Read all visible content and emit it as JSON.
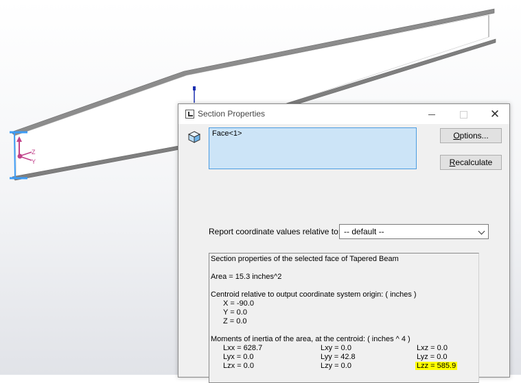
{
  "dialog": {
    "title": "Section Properties",
    "selection_items": [
      "Face<1>"
    ],
    "buttons": {
      "options": {
        "prefix": "",
        "mnemonic": "O",
        "rest": "ptions..."
      },
      "recalculate": {
        "prefix": "",
        "mnemonic": "R",
        "rest": "ecalculate"
      }
    },
    "report_label": "Report coordinate values relative to:",
    "coordinate_system": "-- default --",
    "results": {
      "heading": "Section properties of the selected face of Tapered Beam",
      "area": "Area = 15.3 inches^2",
      "centroid_heading": "Centroid relative to output coordinate system origin: ( inches )",
      "centroid": [
        "X = -90.0",
        "Y = 0.0",
        "Z = 0.0"
      ],
      "moments_heading": "Moments of inertia of the area, at the centroid: ( inches ^ 4 )",
      "moments": [
        [
          "Lxx = 628.7",
          "Lxy = 0.0",
          "Lxz = 0.0"
        ],
        [
          "Lyx = 0.0",
          "Lyy = 42.8",
          "Lyz = 0.0"
        ],
        [
          "Lzx = 0.0",
          "Lzy = 0.0",
          "Lzz = 585.9"
        ]
      ]
    }
  },
  "viewport": {
    "axis_labels": {
      "z": "Z",
      "y": "Y"
    }
  },
  "colors": {
    "selection_face": "#cce4f7",
    "selection_border": "#4a9be0",
    "highlight": "#ffff00",
    "beam_flange": "#808080",
    "selected_edge": "#3d9cf5",
    "triad": "#c1418a"
  }
}
